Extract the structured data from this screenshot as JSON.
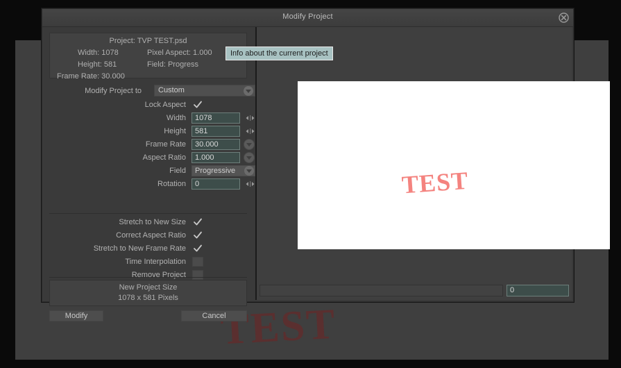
{
  "window": {
    "title": "Modify Project",
    "close_icon": "close-circle-icon"
  },
  "tooltip": {
    "text": "Info about the current project"
  },
  "info_panel": {
    "project": "Project: TVP TEST.psd",
    "width": "Width: 1078",
    "pixel_aspect": "Pixel Aspect: 1.000",
    "height": "Height: 581",
    "field": "Field: Progress",
    "frame_rate": "Frame Rate: 30.000"
  },
  "form": {
    "modify_project_to": {
      "label": "Modify Project to",
      "value": "Custom",
      "icon": "chevron-down-icon"
    },
    "lock_aspect": {
      "label": "Lock Aspect",
      "checked": true,
      "icon": "checkmark-icon"
    },
    "width": {
      "label": "Width",
      "value": "1078",
      "icon": "left-right-arrows-icon"
    },
    "height": {
      "label": "Height",
      "value": "581",
      "icon": "left-right-arrows-icon"
    },
    "frame_rate": {
      "label": "Frame Rate",
      "value": "30.000",
      "icon": "chevron-down-icon"
    },
    "aspect_ratio": {
      "label": "Aspect Ratio",
      "value": "1.000",
      "icon": "chevron-down-icon"
    },
    "field": {
      "label": "Field",
      "value": "Progressive",
      "icon": "chevron-down-icon"
    },
    "rotation": {
      "label": "Rotation",
      "value": "0",
      "icon": "left-right-arrows-icon"
    }
  },
  "options": {
    "stretch_to_new_size": {
      "label": "Stretch to New Size",
      "checked": true,
      "icon": "checkmark-icon"
    },
    "correct_aspect_ratio": {
      "label": "Correct Aspect Ratio",
      "checked": true,
      "icon": "checkmark-icon"
    },
    "stretch_to_new_frame_rate": {
      "label": "Stretch to New Frame Rate",
      "checked": true,
      "icon": "checkmark-icon"
    },
    "time_interpolation": {
      "label": "Time Interpolation",
      "checked": false,
      "icon": "empty-checkbox-icon"
    },
    "remove_project": {
      "label": "Remove Project",
      "checked": false,
      "icon": "empty-checkbox-icon"
    }
  },
  "new_project_size": {
    "title": "New Project Size",
    "value": "1078 x 581 Pixels"
  },
  "buttons": {
    "modify": "Modify",
    "cancel": "Cancel"
  },
  "preview": {
    "canvas_text": "TEST",
    "canvas_text_color": "#f4837f",
    "frame_value": "0"
  },
  "background": {
    "artwork_text": "TEST",
    "artwork_text_color": "#5a2f2f"
  },
  "colors": {
    "window_chrome": "#3a3a3a",
    "panel": "#424242",
    "field_background": "#3d4d4a",
    "field_border": "#6d7f7b",
    "tooltip_background": "#a8c2c2",
    "text": "#b2b2b2"
  }
}
